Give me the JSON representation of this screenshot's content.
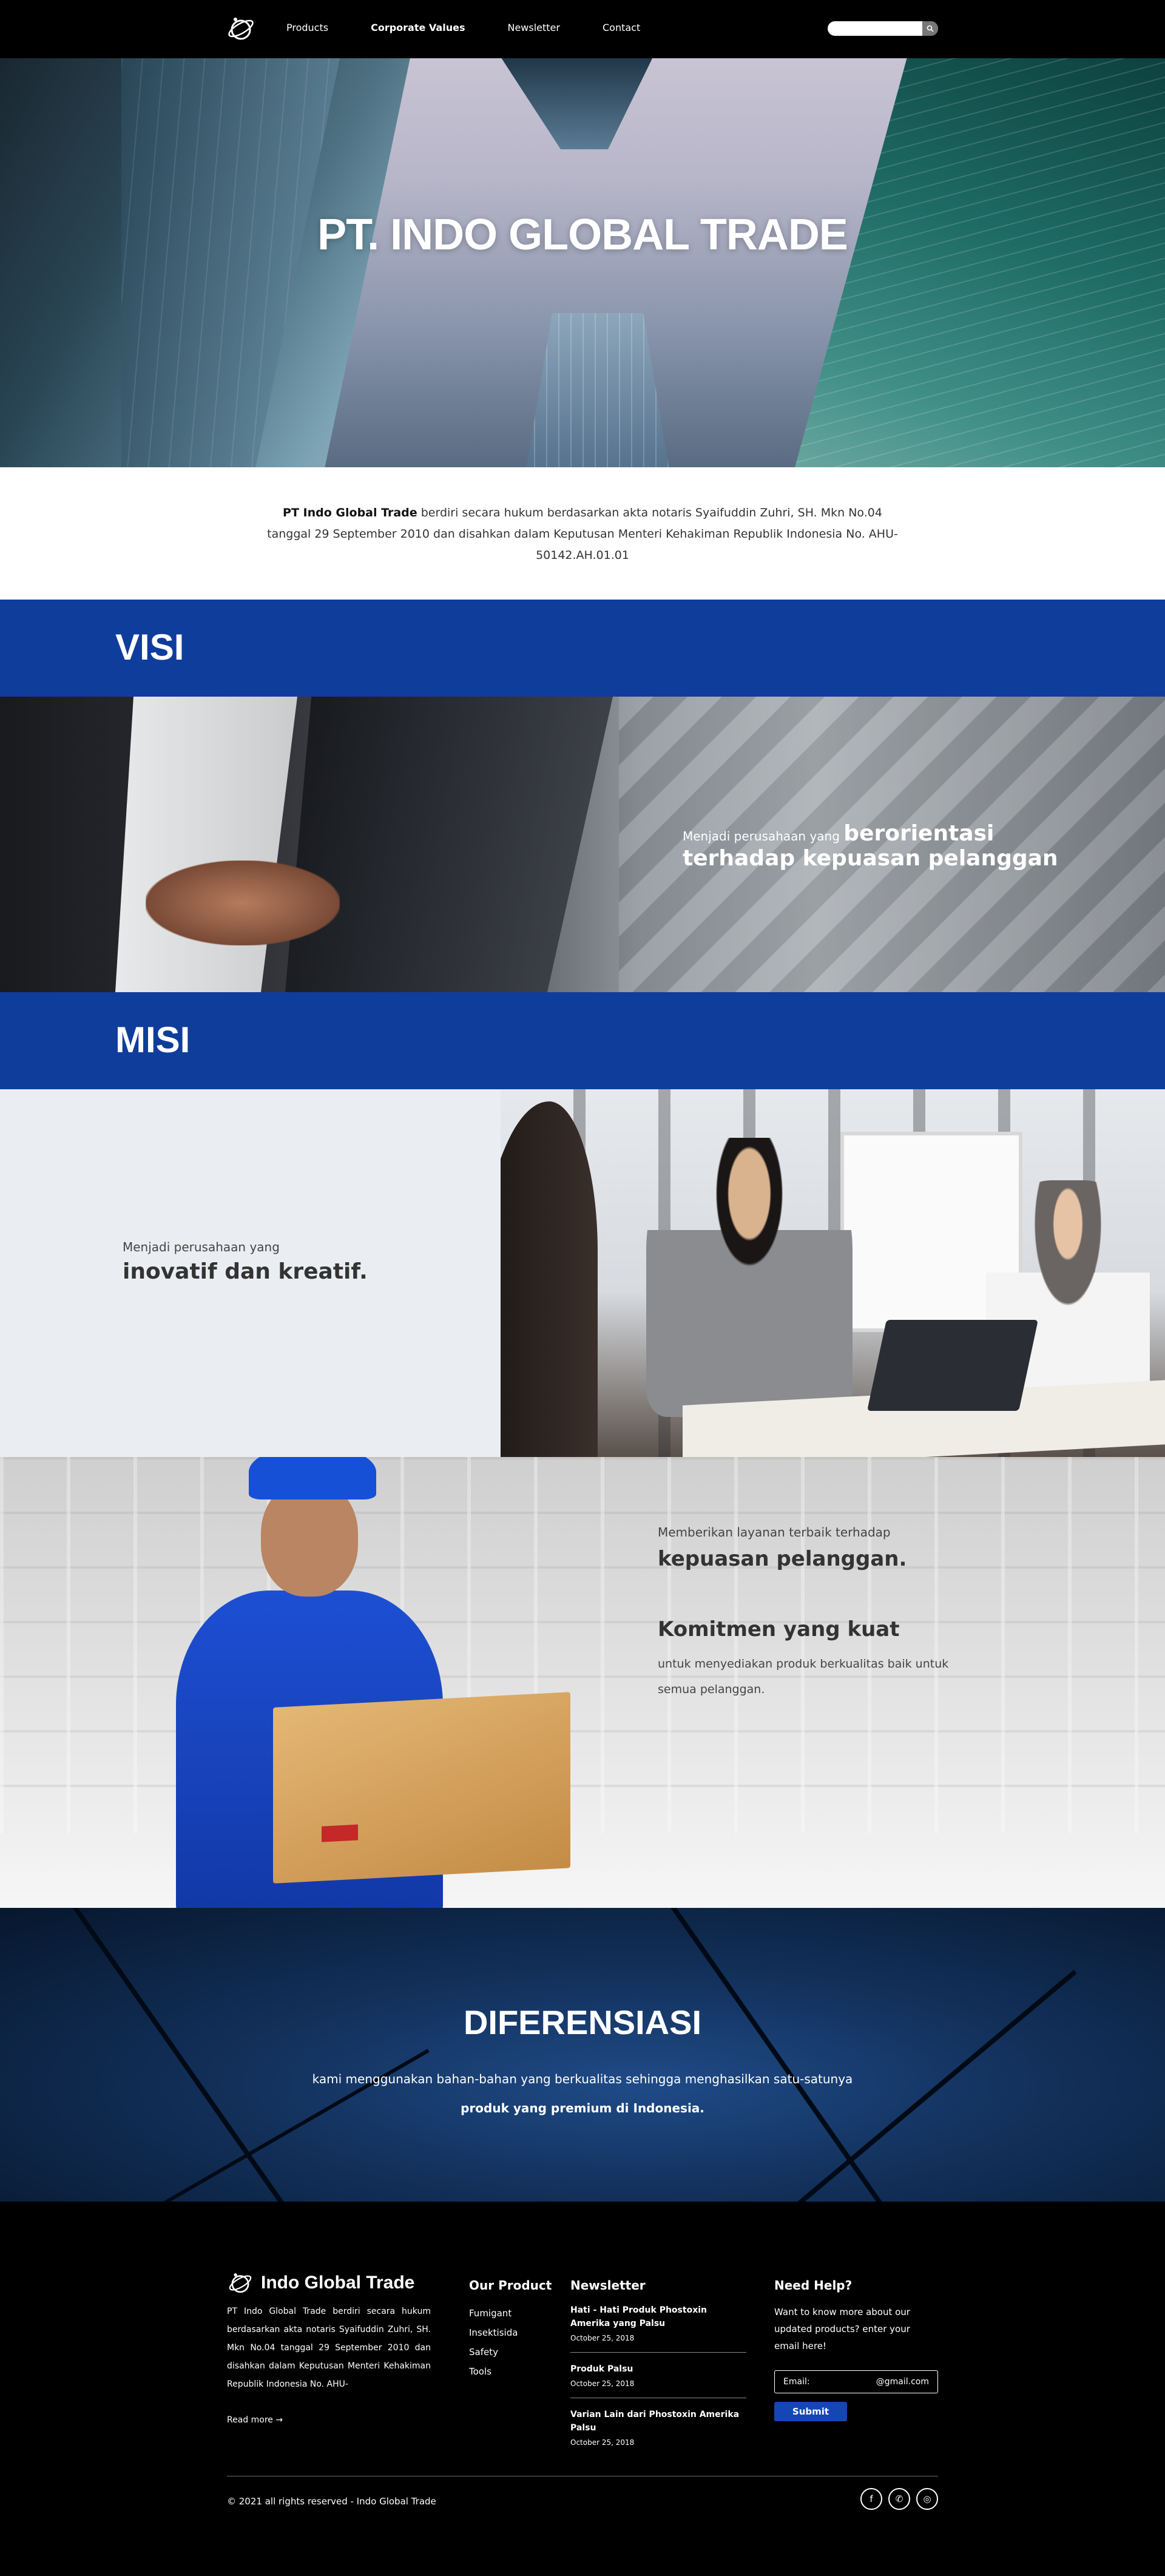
{
  "nav": {
    "items": [
      {
        "label": "Products",
        "active": false
      },
      {
        "label": "Corporate Values",
        "active": true
      },
      {
        "label": "Newsletter",
        "active": false
      },
      {
        "label": "Contact",
        "active": false
      }
    ],
    "search_placeholder": "",
    "search_icon": "search-icon",
    "logo_icon": "globe-logo-icon"
  },
  "hero": {
    "title": "PT. INDO GLOBAL TRADE"
  },
  "intro": {
    "bold": "PT Indo Global Trade",
    "text": " berdiri secara hukum berdasarkan akta notaris Syaifuddin Zuhri, SH. Mkn No.04 tanggal 29 September 2010 dan disahkan dalam Keputusan Menteri Kehakiman Republik Indonesia No. AHU-50142.AH.01.01"
  },
  "visi": {
    "heading": "VISI",
    "lead": "Menjadi perusahaan yang ",
    "bold1": "berorientasi",
    "bold2": "terhadap kepuasan pelanggan"
  },
  "misi": {
    "heading": "MISI",
    "lead": "Menjadi perusahaan yang",
    "bold": "inovatif dan kreatif.",
    "service_lead": "Memberikan layanan terbaik terhadap",
    "service_bold": "kepuasan pelanggan.",
    "commit_bold": "Komitmen yang kuat",
    "commit_text": "untuk menyediakan produk berkualitas baik untuk semua pelanggan."
  },
  "diferensiasi": {
    "heading": "DIFERENSIASI",
    "line1": "kami menggunakan bahan-bahan yang berkualitas sehingga menghasilkan satu-satunya",
    "line2": "produk yang premium di Indonesia."
  },
  "footer": {
    "brand": "Indo Global Trade",
    "about": "PT Indo Global Trade berdiri secara hukum berdasarkan akta notaris Syaifuddin Zuhri, SH. Mkn No.04 tanggal 29 September 2010 dan disahkan dalam Keputusan Menteri Kehakiman Republik Indonesia No. AHU-",
    "read_more": "Read more →",
    "product_heading": "Our Product",
    "products": [
      "Fumigant",
      "Insektisida",
      "Safety",
      "Tools"
    ],
    "news_heading": "Newsletter",
    "news": [
      {
        "title": "Hati - Hati Produk Phostoxin Amerika yang Palsu",
        "date": "October 25, 2018"
      },
      {
        "title": "Produk Palsu",
        "date": "October 25, 2018"
      },
      {
        "title": "Varian Lain dari Phostoxin Amerika Palsu",
        "date": "October 25, 2018"
      }
    ],
    "help_heading": "Need Help?",
    "help_text": "Want to know more about our updated products? enter your email here!",
    "email_label": "Email:",
    "email_suffix": "@gmail.com",
    "submit": "Submit",
    "copyright": "© 2021 all rights reserved - Indo Global Trade",
    "social": [
      {
        "icon": "facebook-icon",
        "glyph": "f"
      },
      {
        "icon": "whatsapp-icon",
        "glyph": "✆"
      },
      {
        "icon": "instagram-icon",
        "glyph": "◎"
      }
    ]
  },
  "colors": {
    "brand_blue": "#0f3d9c",
    "submit_blue": "#1447b4"
  }
}
